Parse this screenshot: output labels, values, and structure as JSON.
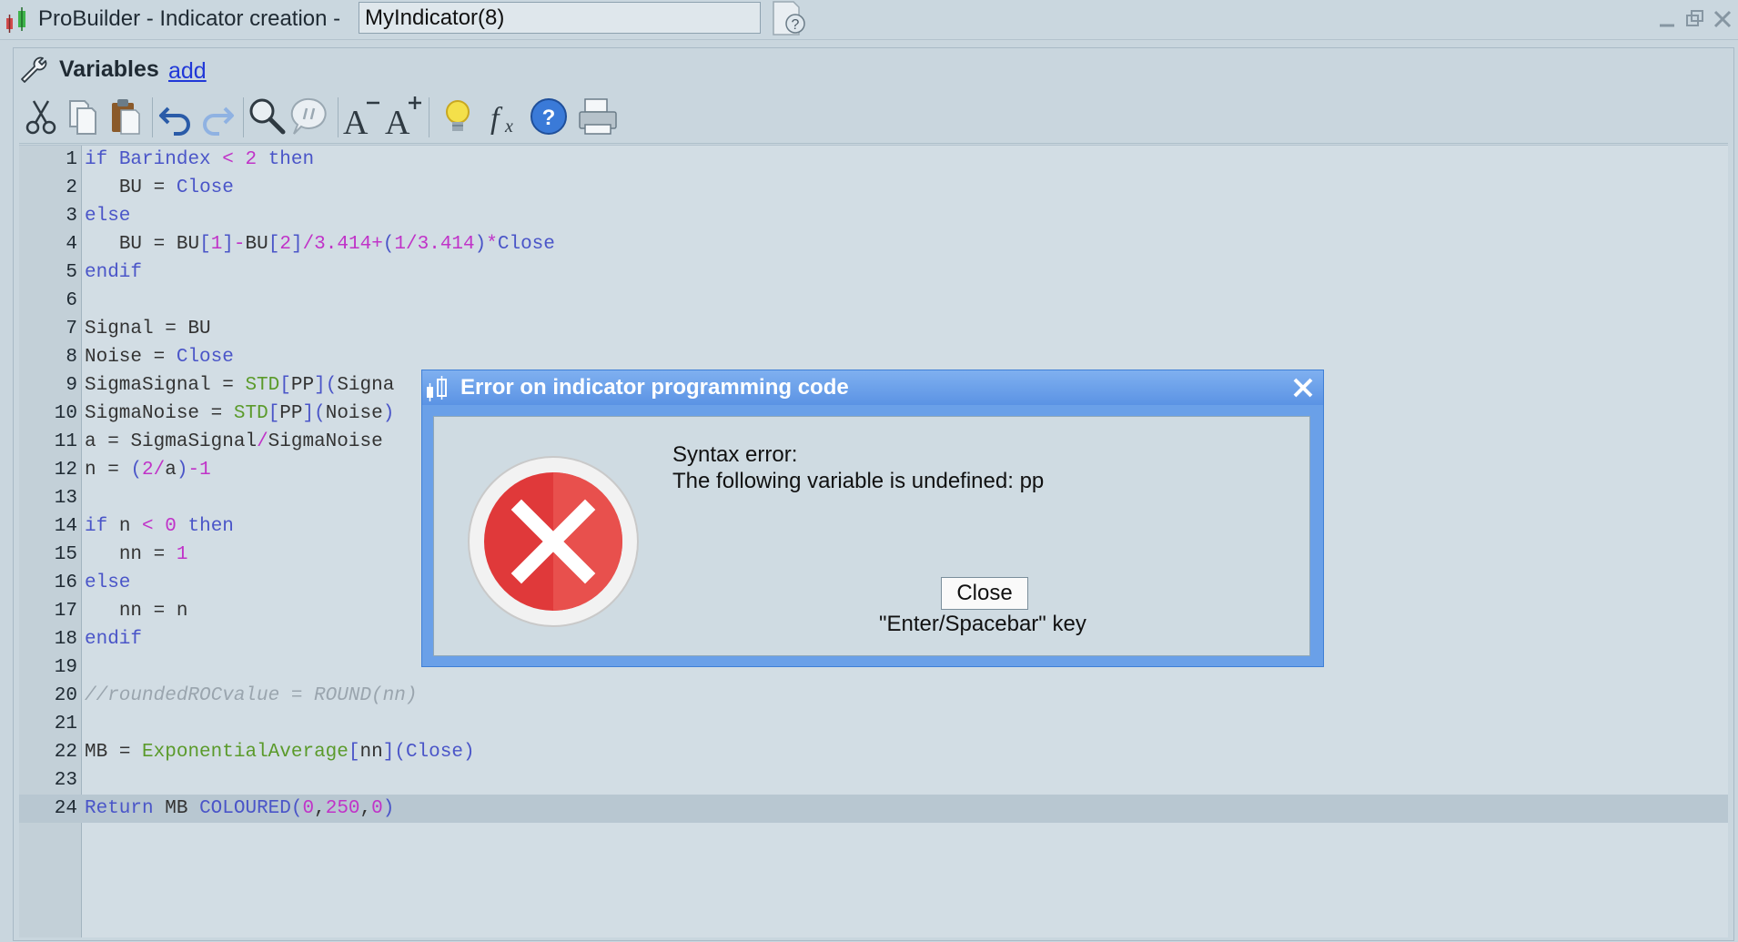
{
  "window": {
    "title": "ProBuilder - Indicator creation -",
    "indicator_name": "MyIndicator(8)"
  },
  "variables_bar": {
    "title": "Variables",
    "add_link": "add"
  },
  "toolbar": {
    "icons": [
      "cut-icon",
      "copy-icon",
      "paste-icon",
      "undo-icon",
      "redo-icon",
      "search-icon",
      "comment-icon",
      "decrease-font-icon",
      "increase-font-icon",
      "idea-icon",
      "function-icon",
      "help-icon",
      "print-icon"
    ]
  },
  "editor": {
    "line_numbers": [
      "1",
      "2",
      "3",
      "4",
      "5",
      "6",
      "7",
      "8",
      "9",
      "10",
      "11",
      "12",
      "13",
      "14",
      "15",
      "16",
      "17",
      "18",
      "19",
      "20",
      "21",
      "22",
      "23",
      "24"
    ],
    "lines": [
      "if Barindex < 2 then",
      "   BU = Close",
      "else",
      "   BU = BU[1]-BU[2]/3.414+(1/3.414)*Close",
      "endif",
      "",
      "Signal = BU",
      "Noise = Close",
      "SigmaSignal = STD[PP](Signa",
      "SigmaNoise = STD[PP](Noise)",
      "a = SigmaSignal/SigmaNoise",
      "n = (2/a)-1",
      "",
      "if n < 0 then",
      "   nn = 1",
      "else",
      "   nn = n",
      "endif",
      "",
      "//roundedROCvalue = ROUND(nn)",
      "",
      "MB = ExponentialAverage[nn](Close)",
      "",
      "Return MB COLOURED(0,250,0)"
    ],
    "active_line": 24
  },
  "dialog": {
    "title": "Error on indicator programming code",
    "message_line1": "Syntax error:",
    "message_line2": "The following variable is undefined: pp",
    "close_button": "Close",
    "key_hint": "\"Enter/Spacebar\" key"
  },
  "colors": {
    "keyword": "#4a55c8",
    "number": "#c033c8",
    "function": "#5a9a2a",
    "comment": "#9aa5ae",
    "dialog_title": "#5b93e4",
    "error_red": "#e0393a"
  }
}
